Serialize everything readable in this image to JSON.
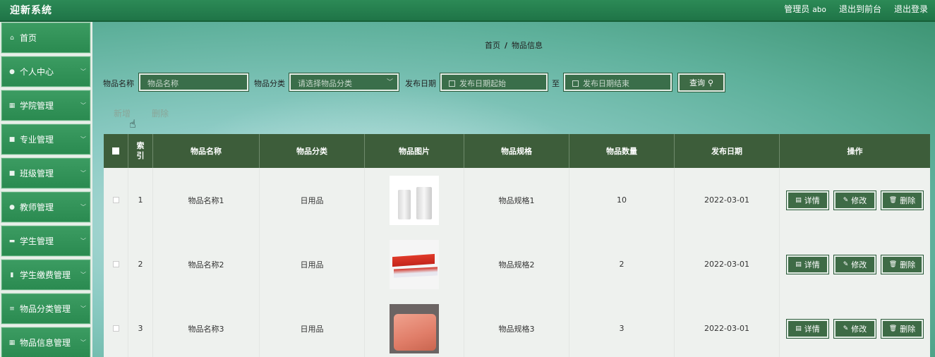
{
  "app": {
    "title": "迎新系统"
  },
  "topbar": {
    "admin_label": "管理员",
    "admin_name": "abo",
    "to_front": "退出到前台",
    "logout": "退出登录"
  },
  "sidebar": {
    "items": [
      {
        "label": "首页",
        "icon": "home-icon",
        "glyph": "⌂",
        "has_children": false
      },
      {
        "label": "个人中心",
        "icon": "user-icon",
        "glyph": "●",
        "has_children": true
      },
      {
        "label": "学院管理",
        "icon": "grid-icon",
        "glyph": "▦",
        "has_children": true
      },
      {
        "label": "专业管理",
        "icon": "doc-icon",
        "glyph": "■",
        "has_children": true
      },
      {
        "label": "班级管理",
        "icon": "doc-icon",
        "glyph": "■",
        "has_children": true
      },
      {
        "label": "教师管理",
        "icon": "user-icon",
        "glyph": "●",
        "has_children": true
      },
      {
        "label": "学生管理",
        "icon": "chat-icon",
        "glyph": "▬",
        "has_children": true
      },
      {
        "label": "学生缴费管理",
        "icon": "bar-chart-icon",
        "glyph": "▮",
        "has_children": true
      },
      {
        "label": "物品分类管理",
        "icon": "list-icon",
        "glyph": "≡",
        "has_children": true
      },
      {
        "label": "物品信息管理",
        "icon": "grid-icon",
        "glyph": "▦",
        "has_children": true
      }
    ]
  },
  "breadcrumb": {
    "home": "首页",
    "separator": "/",
    "current": "物品信息"
  },
  "search": {
    "name_label": "物品名称",
    "name_placeholder": "物品名称",
    "category_label": "物品分类",
    "category_placeholder": "请选择物品分类",
    "date_label": "发布日期",
    "date_start_placeholder": "发布日期起始",
    "date_to": "至",
    "date_end_placeholder": "发布日期结束",
    "query_label": "查询"
  },
  "actions": {
    "add": "新增",
    "delete": "删除"
  },
  "table": {
    "headers": [
      "索引",
      "物品名称",
      "物品分类",
      "物品图片",
      "物品规格",
      "物品数量",
      "发布日期",
      "操作"
    ],
    "index_header_lines": [
      "索",
      "引"
    ],
    "rows": [
      {
        "index": "1",
        "name": "物品名称1",
        "category": "日用品",
        "image": "cups",
        "spec": "物品规格1",
        "qty": "10",
        "date": "2022-03-01"
      },
      {
        "index": "2",
        "name": "物品名称2",
        "category": "日用品",
        "image": "toothpaste",
        "spec": "物品规格2",
        "qty": "2",
        "date": "2022-03-01"
      },
      {
        "index": "3",
        "name": "物品名称3",
        "category": "日用品",
        "image": "quilt",
        "spec": "物品规格3",
        "qty": "3",
        "date": "2022-03-01"
      }
    ],
    "op_detail": "详情",
    "op_edit": "修改",
    "op_delete": "删除"
  }
}
